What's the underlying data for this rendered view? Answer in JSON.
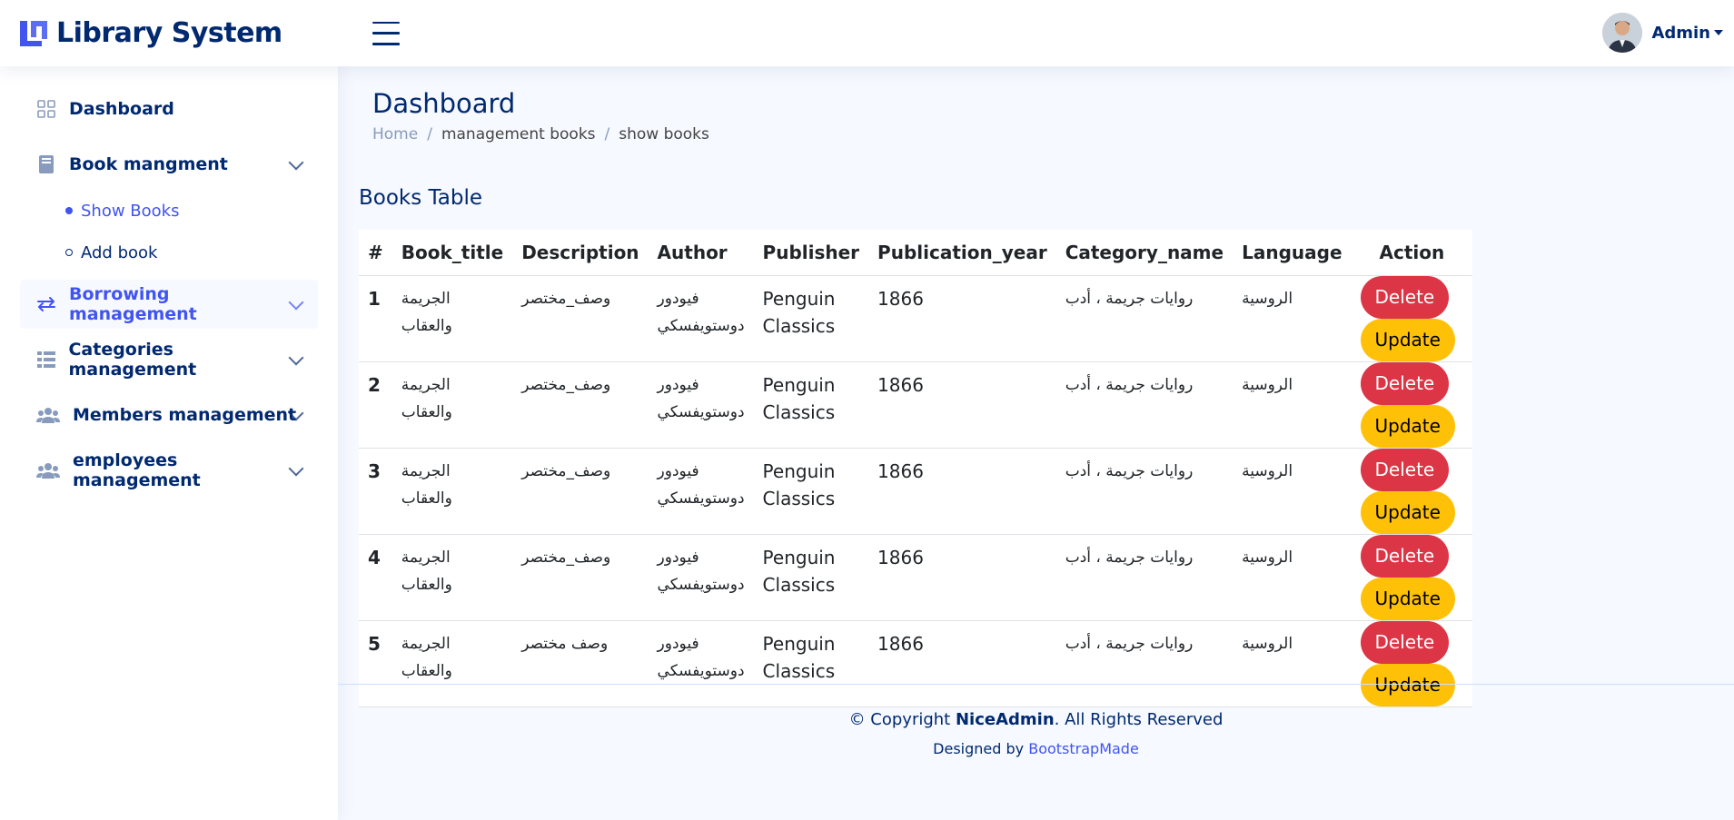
{
  "header": {
    "app_title": "Library System",
    "user_name": "Admin"
  },
  "sidebar": {
    "items": [
      {
        "label": "Dashboard",
        "icon": "grid-icon"
      },
      {
        "label": "Book mangment",
        "icon": "book-icon",
        "sub": [
          {
            "label": "Show Books",
            "active": true
          },
          {
            "label": "Add book",
            "active": false
          }
        ]
      },
      {
        "label": "Borrowing management",
        "icon": "arrows-exchange-icon",
        "active": true
      },
      {
        "label": "Categories management",
        "icon": "table-list-icon"
      },
      {
        "label": "Members management",
        "icon": "people-icon"
      },
      {
        "label": "employees management",
        "icon": "people-icon"
      }
    ]
  },
  "page": {
    "title": "Dashboard",
    "breadcrumb": [
      "Home",
      "management books",
      "show books"
    ],
    "card_title": "Books Table"
  },
  "table": {
    "headers": [
      "#",
      "Book_title",
      "Description",
      "Author",
      "Publisher",
      "Publication_year",
      "Category_name",
      "Language",
      "Action"
    ],
    "rows": [
      {
        "num": "1",
        "title": "الجريمة والعقاب",
        "description": "وصف_مختصر",
        "author": "فيودور دوستويفسكي",
        "publisher": "Penguin Classics",
        "year": "1866",
        "category": "روايات جريمة ، أدب",
        "language": "الروسية"
      },
      {
        "num": "2",
        "title": "الجريمة والعقاب",
        "description": "وصف_مختصر",
        "author": "فيودور دوستويفسكي",
        "publisher": "Penguin Classics",
        "year": "1866",
        "category": "روايات جريمة ، أدب",
        "language": "الروسية"
      },
      {
        "num": "3",
        "title": "الجريمة والعقاب",
        "description": "وصف_مختصر",
        "author": "فيودور دوستويفسكي",
        "publisher": "Penguin Classics",
        "year": "1866",
        "category": "روايات جريمة ، أدب",
        "language": "الروسية"
      },
      {
        "num": "4",
        "title": "الجريمة والعقاب",
        "description": "وصف_مختصر",
        "author": "فيودور دوستويفسكي",
        "publisher": "Penguin Classics",
        "year": "1866",
        "category": "روايات جريمة ، أدب",
        "language": "الروسية"
      },
      {
        "num": "5",
        "title": "الجريمة والعقاب",
        "description": "وصف مختصر",
        "author": "فيودور دوستويفسكي",
        "publisher": "Penguin Classics",
        "year": "1866",
        "category": "روايات جريمة ، أدب",
        "language": "الروسية"
      }
    ],
    "delete_label": "Delete",
    "update_label": "Update"
  },
  "footer": {
    "copyright_prefix": "© Copyright",
    "brand": "NiceAdmin",
    "copyright_suffix": ". All Rights Reserved",
    "designed_by": "Designed by",
    "designer": "BootstrapMade"
  },
  "colors": {
    "primary": "#4154f1",
    "navy": "#012970",
    "delete": "#dc3545",
    "update": "#ffc107",
    "background": "#f6f9ff"
  }
}
